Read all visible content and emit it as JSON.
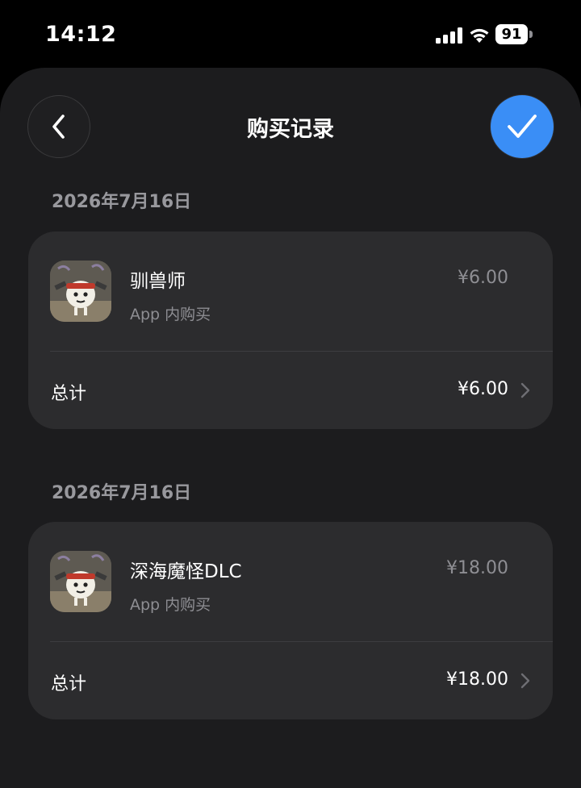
{
  "status_bar": {
    "time": "14:12",
    "battery": "91",
    "icons": [
      "signal-icon",
      "wifi-icon",
      "battery-icon"
    ]
  },
  "nav": {
    "title": "购买记录",
    "back_icon": "chevron-left-icon",
    "confirm_icon": "checkmark-icon"
  },
  "colors": {
    "background": "#1c1c1e",
    "card": "#2c2c2e",
    "accent": "#3a8ef6",
    "secondary_text": "#8e8e93"
  },
  "purchases": [
    {
      "date": "2026年7月16日",
      "item_name": "驯兽师",
      "item_type": "App 内购买",
      "item_price": "¥6.00",
      "total_label": "总计",
      "total_price": "¥6.00"
    },
    {
      "date": "2026年7月16日",
      "item_name": "深海魔怪DLC",
      "item_type": "App 内购买",
      "item_price": "¥18.00",
      "total_label": "总计",
      "total_price": "¥18.00"
    }
  ]
}
